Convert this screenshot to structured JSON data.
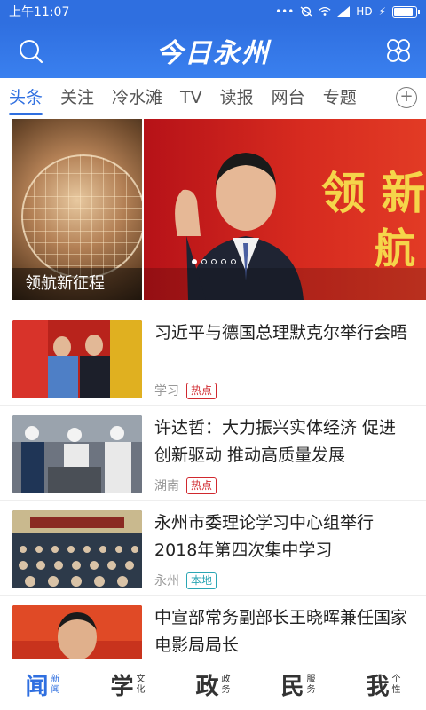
{
  "status_bar": {
    "time": "上午11:07",
    "network": "HD",
    "battery_level": 0.9
  },
  "header": {
    "logo": "今日永州",
    "search_icon": "search-icon",
    "menu_icon": "grid-menu-icon"
  },
  "tabs": {
    "items": [
      "头条",
      "关注",
      "冷水滩",
      "TV",
      "读报",
      "网台",
      "专题"
    ],
    "active": "头条",
    "add_label": "+"
  },
  "carousel": {
    "left_caption": "领航新征程",
    "main_slogan_1": "领  新",
    "main_slogan_2": "航",
    "active_dot": 0,
    "dot_count": 5
  },
  "news": [
    {
      "title": "习近平与德国总理默克尔举行会晤",
      "source": "学习",
      "badge": "热点",
      "badge_type": "hot"
    },
    {
      "title": "许达哲：大力振兴实体经济 促进创新驱动 推动高质量发展",
      "source": "湖南",
      "badge": "热点",
      "badge_type": "hot"
    },
    {
      "title": "永州市委理论学习中心组举行2018年第四次集中学习",
      "source": "永州",
      "badge": "本地",
      "badge_type": "local"
    },
    {
      "title": "中宣部常务副部长王晓晖兼任国家电影局局长",
      "source": "",
      "badge": "",
      "badge_type": ""
    }
  ],
  "bottom_nav": [
    {
      "big": "闻",
      "small_1": "新",
      "small_2": "闻",
      "active": true
    },
    {
      "big": "学",
      "small_1": "文",
      "small_2": "化",
      "active": false
    },
    {
      "big": "政",
      "small_1": "政",
      "small_2": "务",
      "active": false
    },
    {
      "big": "民",
      "small_1": "服",
      "small_2": "务",
      "active": false
    },
    {
      "big": "我",
      "small_1": "个",
      "small_2": "性",
      "active": false
    }
  ],
  "colors": {
    "brand": "#2f6fe0",
    "hot": "#d0282e",
    "local": "#2aa6b4"
  }
}
